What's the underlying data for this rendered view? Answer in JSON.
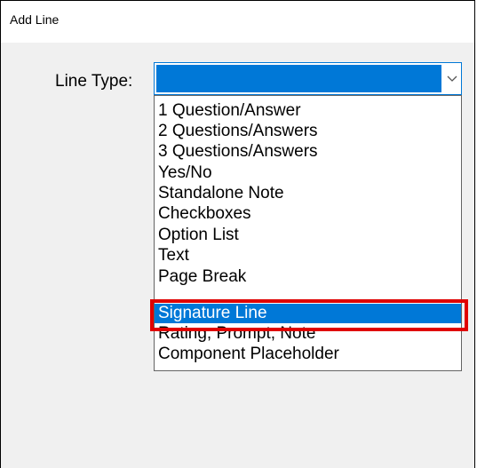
{
  "window": {
    "title": "Add Line"
  },
  "line_type": {
    "label": "Line Type:",
    "selected_value": "",
    "options": [
      "1 Question/Answer",
      "2 Questions/Answers",
      "3 Questions/Answers",
      "Yes/No",
      "Standalone Note",
      "Checkboxes",
      "Option List",
      "Text",
      "Page Break",
      "Signature Line",
      "Rating, Prompt, Note",
      "Component Placeholder"
    ],
    "highlighted_option": "Signature Line"
  },
  "colors": {
    "selection": "#0078d7",
    "highlight_border": "#e00000",
    "dialog_bg": "#f0f0f0"
  }
}
